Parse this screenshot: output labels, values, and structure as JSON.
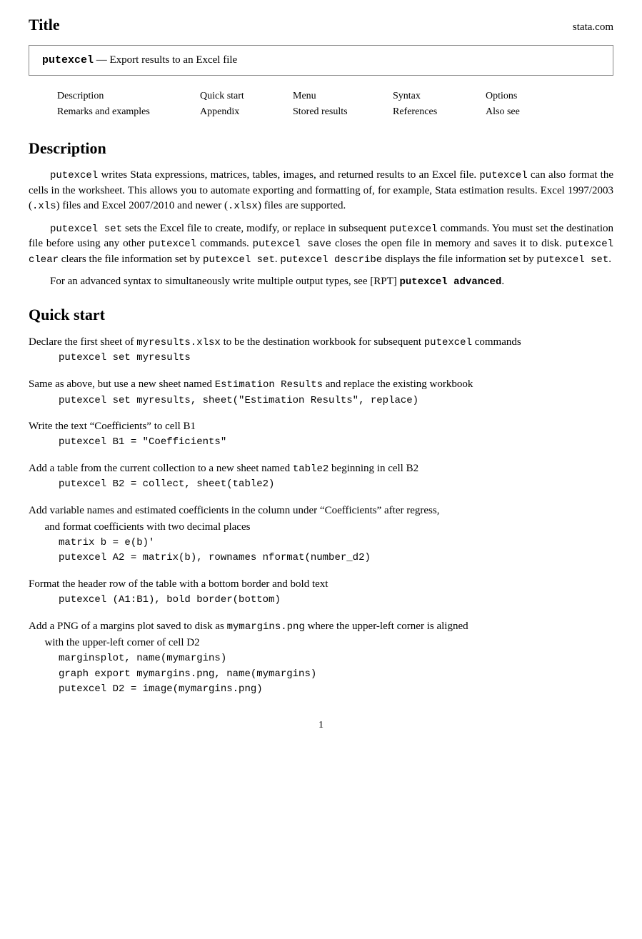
{
  "header": {
    "title": "Title",
    "stata_com": "stata.com"
  },
  "title_box": {
    "command": "putexcel",
    "separator": " — ",
    "description": "Export results to an Excel file"
  },
  "nav": {
    "col1_row1": "Description",
    "col1_row2": "Remarks and examples",
    "col2_row1": "Quick start",
    "col2_row2": "Appendix",
    "col3_row1": "Menu",
    "col3_row2": "Stored results",
    "col4_row1": "Syntax",
    "col4_row2": "References",
    "col5_row1": "Options",
    "col5_row2": "Also see"
  },
  "description": {
    "heading": "Description",
    "para1": "putexcel writes Stata expressions, matrices, tables, images, and returned results to an Excel file. putexcel can also format the cells in the worksheet. This allows you to automate exporting and formatting of, for example, Stata estimation results. Excel 1997/2003 (.xls) files and Excel 2007/2010 and newer (.xlsx) files are supported.",
    "para2_pre": "putexcel set sets the Excel file to create, modify, or replace in subsequent putexcel commands. You must set the destination file before using any other putexcel commands. putexcel save closes the open file in memory and saves it to disk. putexcel clear clears the file information set by putexcel set. putexcel describe displays the file information set by putexcel set.",
    "para3": "For an advanced syntax to simultaneously write multiple output types, see [RPT] putexcel advanced."
  },
  "quick_start": {
    "heading": "Quick start",
    "items": [
      {
        "text": "Declare the first sheet of myresults.xlsx to be the destination workbook for subsequent putexcel commands",
        "code": [
          "putexcel set myresults"
        ]
      },
      {
        "text": "Same as above, but use a new sheet named Estimation Results and replace the existing workbook",
        "code": [
          "putexcel set myresults, sheet(\"Estimation Results\", replace)"
        ]
      },
      {
        "text": "Write the text “Coefficients” to cell B1",
        "code": [
          "putexcel B1 = \"Coefficients\""
        ]
      },
      {
        "text": "Add a table from the current collection to a new sheet named table2 beginning in cell B2",
        "code": [
          "putexcel B2 = collect, sheet(table2)"
        ]
      },
      {
        "text": "Add variable names and estimated coefficients in the column under “Coefficients” after regress, and format coefficients with two decimal places",
        "code": [
          "matrix b = e(b)'",
          "putexcel A2 = matrix(b), rownames nformat(number_d2)"
        ]
      },
      {
        "text": "Format the header row of the table with a bottom border and bold text",
        "code": [
          "putexcel (A1:B1), bold border(bottom)"
        ]
      },
      {
        "text": "Add a PNG of a margins plot saved to disk as mymargins.png where the upper-left corner is aligned with the upper-left corner of cell D2",
        "code": [
          "marginsplot, name(mymargins)",
          "graph export mymargins.png, name(mymargins)",
          "putexcel D2 = image(mymargins.png)"
        ]
      }
    ]
  },
  "page_number": "1"
}
